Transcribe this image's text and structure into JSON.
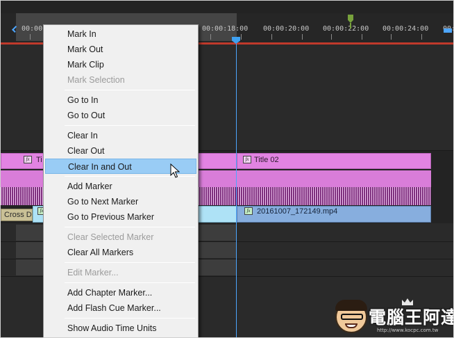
{
  "timeline": {
    "ruler_labels": [
      "00:00",
      "00:00:18:00",
      "00:00:20:00",
      "00:00:22:00",
      "00:00:24:00",
      "00:0"
    ],
    "accent_color": "#4da6ff",
    "workarea_color": "#c0392b"
  },
  "clips": {
    "title_left_label": "Ti",
    "title_right_label": "Title 02",
    "transition_label": "Cross D",
    "video_clip_label": "20161007_172149.mp4",
    "fx_label": "fx"
  },
  "context_menu": {
    "groups": [
      [
        {
          "label": "Mark In",
          "enabled": true
        },
        {
          "label": "Mark Out",
          "enabled": true
        },
        {
          "label": "Mark Clip",
          "enabled": true
        },
        {
          "label": "Mark Selection",
          "enabled": false
        }
      ],
      [
        {
          "label": "Go to In",
          "enabled": true
        },
        {
          "label": "Go to Out",
          "enabled": true
        }
      ],
      [
        {
          "label": "Clear In",
          "enabled": true
        },
        {
          "label": "Clear Out",
          "enabled": true
        },
        {
          "label": "Clear In and Out",
          "enabled": true,
          "highlighted": true
        }
      ],
      [
        {
          "label": "Add Marker",
          "enabled": true
        },
        {
          "label": "Go to Next Marker",
          "enabled": true
        },
        {
          "label": "Go to Previous Marker",
          "enabled": true
        }
      ],
      [
        {
          "label": "Clear Selected Marker",
          "enabled": false
        },
        {
          "label": "Clear All Markers",
          "enabled": true
        }
      ],
      [
        {
          "label": "Edit Marker...",
          "enabled": false
        }
      ],
      [
        {
          "label": "Add Chapter Marker...",
          "enabled": true
        },
        {
          "label": "Add Flash Cue Marker...",
          "enabled": true
        }
      ],
      [
        {
          "label": "Show Audio Time Units",
          "enabled": true
        }
      ]
    ],
    "highlight_color": "#99ccf5"
  },
  "watermark": {
    "text": "電腦王阿達",
    "url": "http://www.kocpc.com.tw"
  }
}
